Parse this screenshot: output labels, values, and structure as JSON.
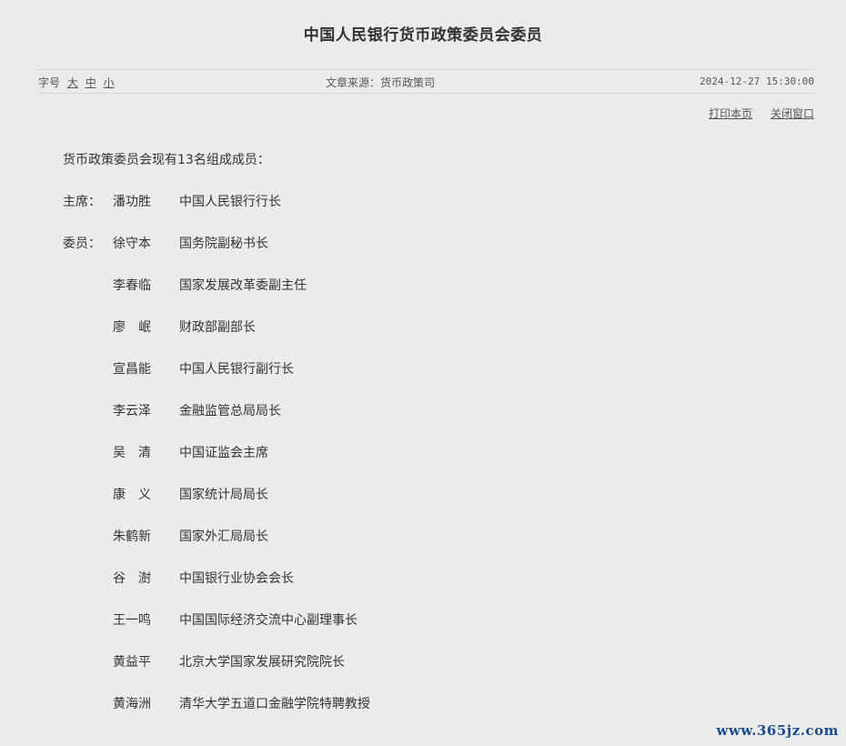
{
  "title": "中国人民银行货币政策委员会委员",
  "meta": {
    "font_label": "字号",
    "font_sizes": [
      "大",
      "中",
      "小"
    ],
    "source": "文章来源：货币政策司",
    "datetime": "2024-12-27 15:30:00"
  },
  "actions": {
    "print": "打印本页",
    "close": "关闭窗口"
  },
  "intro": "货币政策委员会现有13名组成成员：",
  "members": [
    {
      "role": "主席：",
      "name": "潘功胜",
      "position": "中国人民银行行长"
    },
    {
      "role": "委员：",
      "name": "徐守本",
      "position": "国务院副秘书长"
    },
    {
      "role": "",
      "name": "李春临",
      "position": "国家发展改革委副主任"
    },
    {
      "role": "",
      "name": "廖　岷",
      "position": "财政部副部长"
    },
    {
      "role": "",
      "name": "宣昌能",
      "position": "中国人民银行副行长"
    },
    {
      "role": "",
      "name": "李云泽",
      "position": "金融监管总局局长"
    },
    {
      "role": "",
      "name": "吴　清",
      "position": "中国证监会主席"
    },
    {
      "role": "",
      "name": "康　义",
      "position": "国家统计局局长"
    },
    {
      "role": "",
      "name": "朱鹤新",
      "position": "国家外汇局局长"
    },
    {
      "role": "",
      "name": "谷　澍",
      "position": "中国银行业协会会长"
    },
    {
      "role": "",
      "name": "王一鸣",
      "position": "中国国际经济交流中心副理事长"
    },
    {
      "role": "",
      "name": "黄益平",
      "position": "北京大学国家发展研究院院长"
    },
    {
      "role": "",
      "name": "黄海洲",
      "position": "清华大学五道口金融学院特聘教授"
    }
  ],
  "watermark": "www.365jz.com"
}
